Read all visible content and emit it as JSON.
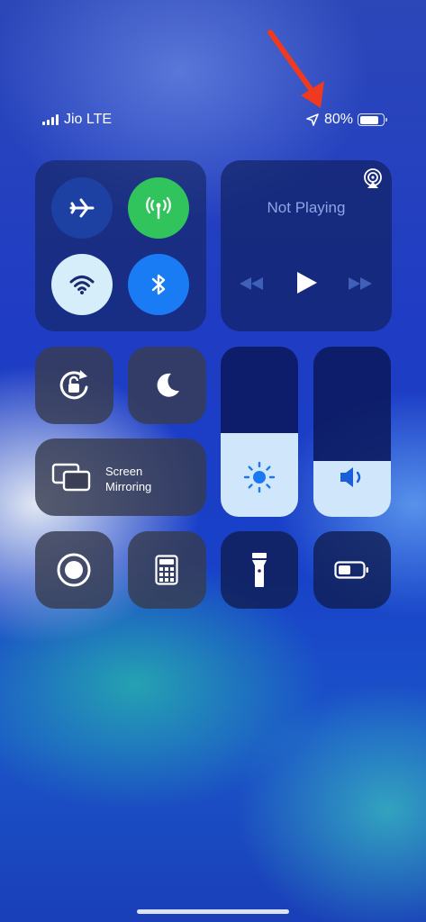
{
  "status_bar": {
    "carrier": "Jio LTE",
    "battery_percent": "80%",
    "battery_level": 0.8
  },
  "connectivity": {
    "airplane": {
      "icon": "airplane-icon",
      "state": "off"
    },
    "cellular": {
      "icon": "cellular-antenna-icon",
      "state": "on",
      "color": "#32c45c"
    },
    "wifi": {
      "icon": "wifi-icon",
      "state": "on",
      "color": "#d6eefa"
    },
    "bluetooth": {
      "icon": "bluetooth-icon",
      "state": "on",
      "color": "#1a7cf5"
    }
  },
  "media": {
    "title": "Not Playing",
    "controls": [
      "rewind-icon",
      "play-icon",
      "fast-forward-icon"
    ],
    "airplay_icon": "airplay-audio-icon"
  },
  "tiles": {
    "rotation_lock": {
      "icon": "rotation-lock-icon"
    },
    "do_not_disturb": {
      "icon": "moon-icon"
    },
    "screen_mirroring": {
      "label_line1": "Screen",
      "label_line2": "Mirroring",
      "icon": "screen-mirroring-icon"
    },
    "screen_recording": {
      "icon": "screen-record-icon"
    },
    "calculator": {
      "icon": "calculator-icon"
    },
    "flashlight": {
      "icon": "flashlight-icon"
    },
    "low_power": {
      "icon": "low-power-battery-icon"
    }
  },
  "sliders": {
    "brightness": {
      "level": 0.49,
      "icon": "sun-icon"
    },
    "volume": {
      "level": 0.33,
      "icon": "speaker-icon"
    }
  },
  "annotation": {
    "arrow_color": "#f03a1f"
  }
}
